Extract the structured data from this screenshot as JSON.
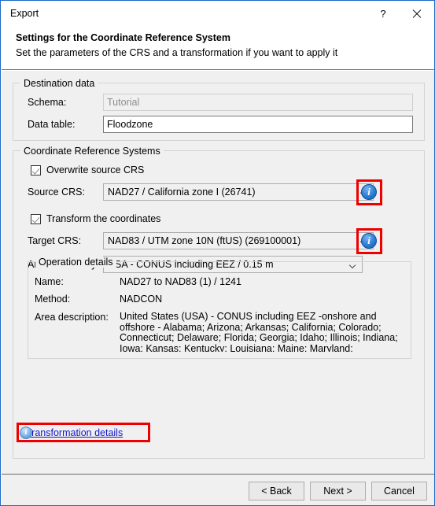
{
  "window": {
    "title": "Export",
    "help_icon": "?",
    "close_icon": "close-icon"
  },
  "header": {
    "title": "Settings for the Coordinate Reference System",
    "subtitle": "Set the parameters of the CRS and a transformation if you want to apply it"
  },
  "destination": {
    "legend": "Destination data",
    "schema_label": "Schema:",
    "schema_value": "Tutorial",
    "datatable_label": "Data table:",
    "datatable_value": "Floodzone"
  },
  "crs": {
    "legend": "Coordinate Reference Systems",
    "overwrite_source_label": "Overwrite source CRS",
    "overwrite_source_checked": true,
    "source_label": "Source CRS:",
    "source_value": "NAD27 / California zone I (26741)",
    "source_info_icon": "info-icon",
    "transform_label": "Transform the coordinates",
    "transform_checked": true,
    "target_label": "Target CRS:",
    "target_value": "NAD83 / UTM zone 10N (ftUS) (269100001)",
    "target_info_icon": "info-icon",
    "area_label": "Area / Accuracy:",
    "area_value": "USA - CONUS including EEZ / 0.15 m"
  },
  "operation": {
    "legend": "Operation details",
    "name_label": "Name:",
    "name_value": "NAD27 to NAD83 (1) / 1241",
    "method_label": "Method:",
    "method_value": "NADCON",
    "area_label": "Area description:",
    "area_value": "United States (USA) - CONUS including EEZ -onshore and offshore - Alabama; Arizona; Arkansas; California; Colorado; Connecticut; Delaware; Florida; Georgia; Idaho; Illinois; Indiana; Iowa; Kansas; Kentucky; Louisiana; Maine; Maryland; Massachusetts; Michigan; Minnesota; Mississippi; Missouri; Montan..."
  },
  "transformation_link": {
    "icon": "info-icon",
    "label": "Transformation details"
  },
  "footer": {
    "back_label": "< Back",
    "next_label": "Next >",
    "cancel_label": "Cancel"
  },
  "colors": {
    "annotation": "#ee0000",
    "window_border": "#1b6ac9",
    "link": "#1414cc"
  }
}
